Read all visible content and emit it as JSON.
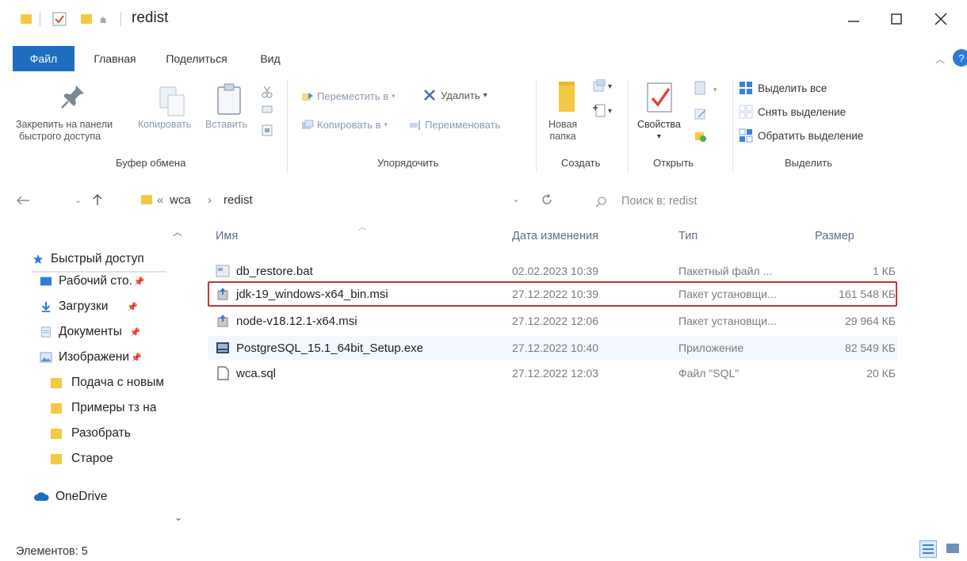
{
  "window": {
    "title": "redist"
  },
  "ribbon_tabs": [
    {
      "label": "Файл"
    },
    {
      "label": "Главная"
    },
    {
      "label": "Поделиться"
    },
    {
      "label": "Вид"
    }
  ],
  "ribbon": {
    "pin_label_1": "Закрепить на панели",
    "pin_label_2": "быстрого доступа",
    "copy_label": "Копировать",
    "paste_label": "Вставить",
    "move_to_label": "Переместить в",
    "copy_to_label": "Копировать в",
    "delete_label": "Удалить",
    "rename_label": "Переименовать",
    "new_folder_label_1": "Новая",
    "new_folder_label_2": "папка",
    "properties_label": "Свойства",
    "select_all_label": "Выделить все",
    "deselect_label": "Снять выделение",
    "invert_selection_label": "Обратить выделение",
    "groups": {
      "clipboard": "Буфер обмена",
      "organize": "Упорядочить",
      "create": "Создать",
      "open": "Открыть",
      "select": "Выделить"
    }
  },
  "address": {
    "crumbs": [
      "wca",
      "redist"
    ],
    "search_placeholder": "Поиск в: redist"
  },
  "nav": {
    "quick_access": "Быстрый доступ",
    "items": [
      {
        "label": "Рабочий сто.",
        "pinned": true
      },
      {
        "label": "Загрузки",
        "pinned": true
      },
      {
        "label": "Документы",
        "pinned": true
      },
      {
        "label": "Изображени",
        "pinned": true
      },
      {
        "label": "Подача с новым"
      },
      {
        "label": "Примеры тз на"
      },
      {
        "label": "Разобрать"
      },
      {
        "label": "Старое"
      }
    ],
    "onedrive": "OneDrive"
  },
  "columns": {
    "name": "Имя",
    "date": "Дата изменения",
    "type": "Тип",
    "size": "Размер"
  },
  "files": [
    {
      "name": "db_restore.bat",
      "date": "02.02.2023 10:39",
      "type": "Пакетный файл ...",
      "size": "1 КБ",
      "icon": "batch-file-icon"
    },
    {
      "name": "jdk-19_windows-x64_bin.msi",
      "date": "27.12.2022 10:39",
      "type": "Пакет установщи...",
      "size": "161 548 КБ",
      "icon": "installer-package-icon"
    },
    {
      "name": "node-v18.12.1-x64.msi",
      "date": "27.12.2022 12:06",
      "type": "Пакет установщи...",
      "size": "29 964 КБ",
      "icon": "installer-package-icon"
    },
    {
      "name": "PostgreSQL_15.1_64bit_Setup.exe",
      "date": "27.12.2022 10:40",
      "type": "Приложение",
      "size": "82 549 КБ",
      "icon": "application-icon"
    },
    {
      "name": "wca.sql",
      "date": "27.12.2022 12:03",
      "type": "Файл \"SQL\"",
      "size": "20 КБ",
      "icon": "text-file-icon"
    }
  ],
  "status": {
    "items_count": "Элементов: 5"
  },
  "colors": {
    "accent": "#1e6dc1",
    "highlight_border": "#c8323c",
    "folder": "#f4c842"
  }
}
